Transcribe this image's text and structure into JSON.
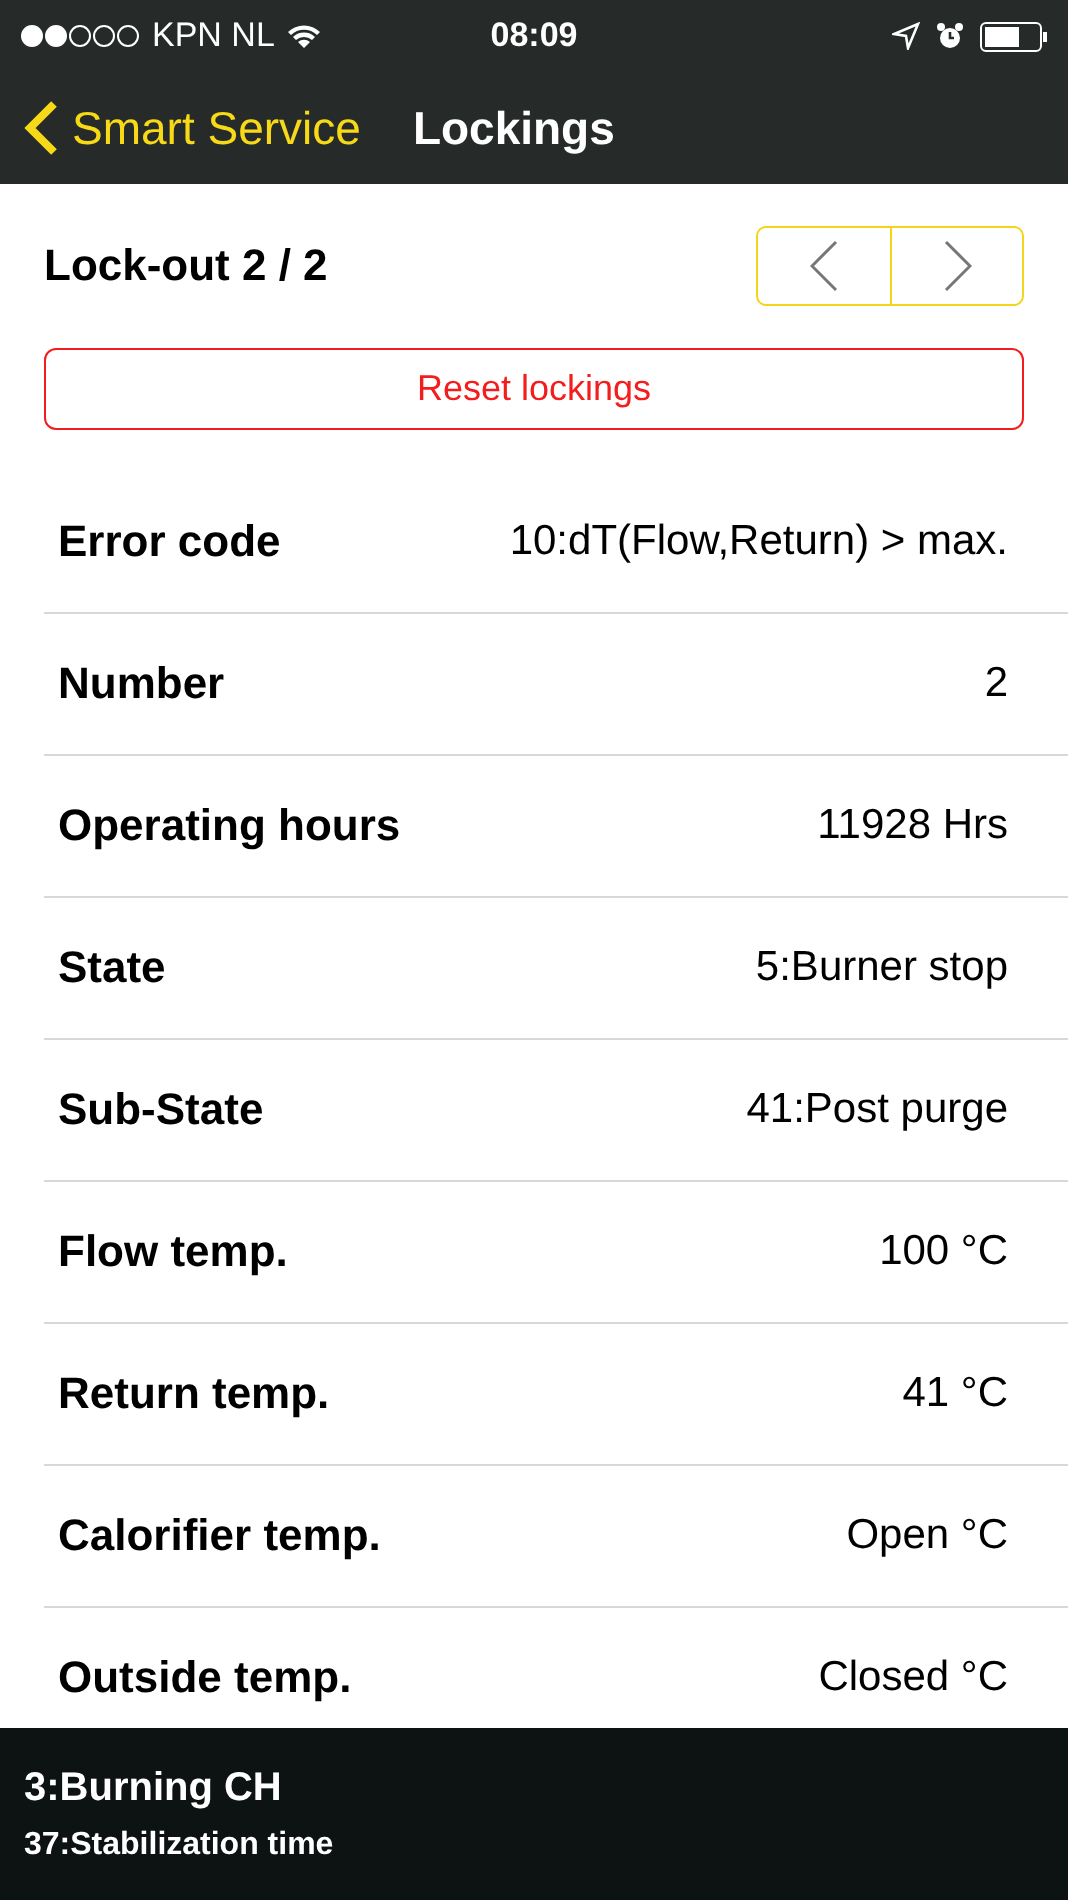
{
  "status_bar": {
    "carrier": "KPN NL",
    "time": "08:09"
  },
  "nav": {
    "back_label": "Smart Service",
    "title": "Lockings"
  },
  "lockout": {
    "title": "Lock-out 2 / 2",
    "reset_button": "Reset lockings"
  },
  "rows": [
    {
      "label": "Error code",
      "value": "10:dT(Flow,Return) > max."
    },
    {
      "label": "Number",
      "value": "2"
    },
    {
      "label": "Operating hours",
      "value": "11928 Hrs"
    },
    {
      "label": "State",
      "value": "5:Burner stop"
    },
    {
      "label": "Sub-State",
      "value": "41:Post purge"
    },
    {
      "label": "Flow temp.",
      "value": "100 °C"
    },
    {
      "label": "Return temp.",
      "value": "41 °C"
    },
    {
      "label": "Calorifier temp.",
      "value": "Open °C"
    },
    {
      "label": "Outside temp.",
      "value": "Closed °C"
    }
  ],
  "footer": {
    "state": "3:Burning CH",
    "sub_state": "37:Stabilization time"
  }
}
